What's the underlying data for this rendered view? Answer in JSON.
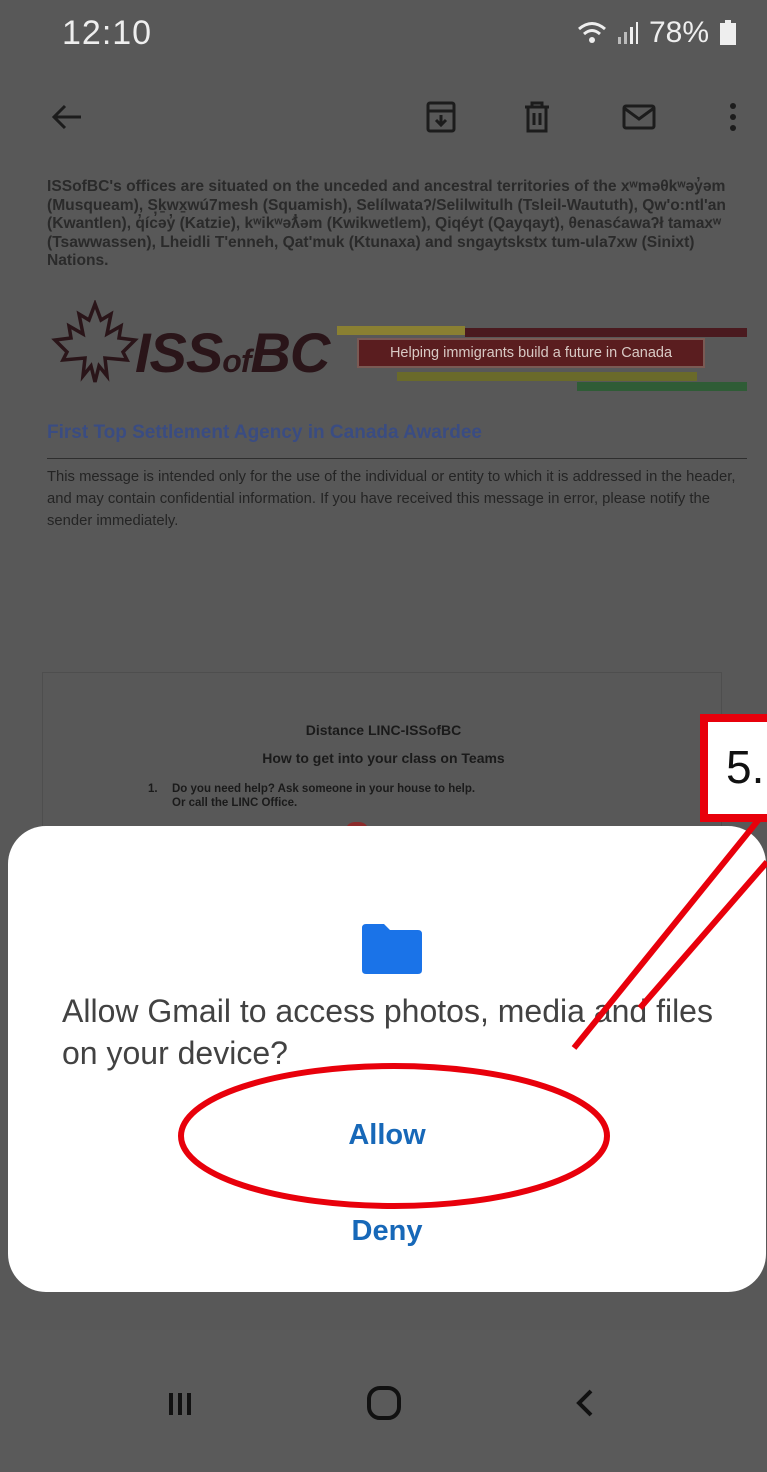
{
  "status_bar": {
    "time": "12:10",
    "battery": "78%"
  },
  "toolbar": {
    "icons": [
      "back-arrow-icon",
      "archive-icon",
      "delete-icon",
      "mark-unread-icon",
      "more-vert-icon"
    ]
  },
  "email": {
    "acknowledgement": "ISSofBC's offices are situated on the unceded and ancestral territories of the xʷməθkʷəy̓əm (Musqueam), Sḵwx̱wú7mesh (Squamish), Selílwataʔ/Selilwitulh (Tsleil-Waututh), Qw'o:ntl'an (Kwantlen), q̓íc̓əy̓ (Katzie), kʷikʷəƛ̓əm (Kwikwetlem), Qiqéyt (Qayqayt), θenasćawaʔł tamaxʷ (Tsawwassen), Lheidli T'enneh, Qat'muk (Ktunaxa) and sngaytskstx tum-ula7xw  (Sinixt) Nations.",
    "logo_text": "ISS",
    "logo_of": "of",
    "logo_bc": "BC",
    "banner_tagline": "Helping immigrants build a future in Canada",
    "awardee": "First Top Settlement Agency in Canada Awardee",
    "disclaimer": "This message is intended only for the use of the individual or entity to which it is addressed in the header, and may contain confidential information. If you have received this message in error, please notify the sender immediately."
  },
  "attachment": {
    "title": "Distance LINC-ISSofBC",
    "subtitle": "How to get into your class on Teams",
    "step_number": "1.",
    "step_line1": "Do you need help?  Ask someone in your house to help.",
    "step_line2": "Or call the LINC Office."
  },
  "dialog": {
    "icon": "folder-icon",
    "message": "Allow Gmail to access photos, media and files on your device?",
    "allow_label": "Allow",
    "deny_label": "Deny"
  },
  "nav_bar": {
    "icons": [
      "recents-icon",
      "home-icon",
      "back-icon"
    ]
  },
  "annotation": {
    "step_label": "5.",
    "color": "#e8000b"
  }
}
